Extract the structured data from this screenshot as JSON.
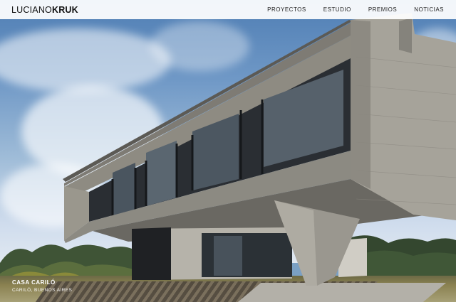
{
  "brand": {
    "name_light": "LUCIANO",
    "name_bold": "KRUK"
  },
  "nav": {
    "items": [
      {
        "label": "PROYECTOS"
      },
      {
        "label": "ESTUDIO"
      },
      {
        "label": "PREMIOS"
      },
      {
        "label": "NOTICIAS"
      }
    ]
  },
  "project": {
    "title": "CASA CARILÓ",
    "location": "CARILÓ, BUENOS AIRES"
  },
  "colors": {
    "nav_background": "#ffffff",
    "text_dark": "#111111",
    "caption_text": "#ffffff",
    "concrete": "#9b9a92",
    "glass": "#2c3034"
  }
}
